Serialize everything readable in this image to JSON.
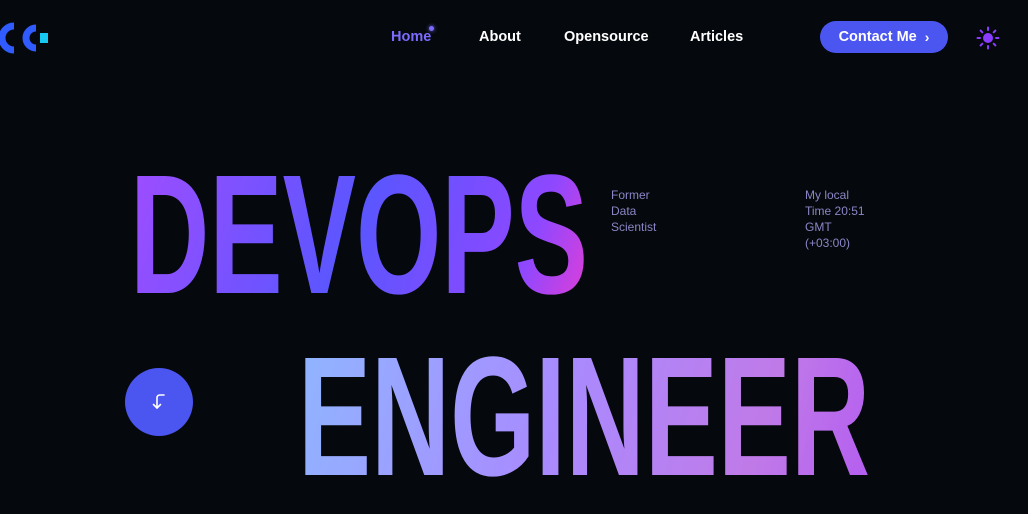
{
  "nav": {
    "links": [
      {
        "label": "Home",
        "active": true
      },
      {
        "label": "About",
        "active": false
      },
      {
        "label": "Opensource",
        "active": false
      },
      {
        "label": "Articles",
        "active": false
      }
    ],
    "contact_label": "Contact Me"
  },
  "hero": {
    "line1": "DEVOPS",
    "line2": "ENGINEER",
    "former": [
      "Former",
      "Data",
      "Scientist"
    ],
    "local_time": [
      "My local",
      "Time 20:51",
      "GMT",
      "(+03:00)"
    ]
  },
  "colors": {
    "background": "#05080c",
    "accent": "#4b55f0",
    "active_link": "#7b6bff",
    "logo_blue": "#2f5bff",
    "logo_cyan": "#17c9f0",
    "side_text": "#8b86c6",
    "sun_icon": "#8a3dff"
  },
  "icons": {
    "logo": "cc-logo-icon",
    "contact": "chevron-right-icon",
    "theme": "sun-icon",
    "scroll": "arrow-down-left-icon"
  }
}
